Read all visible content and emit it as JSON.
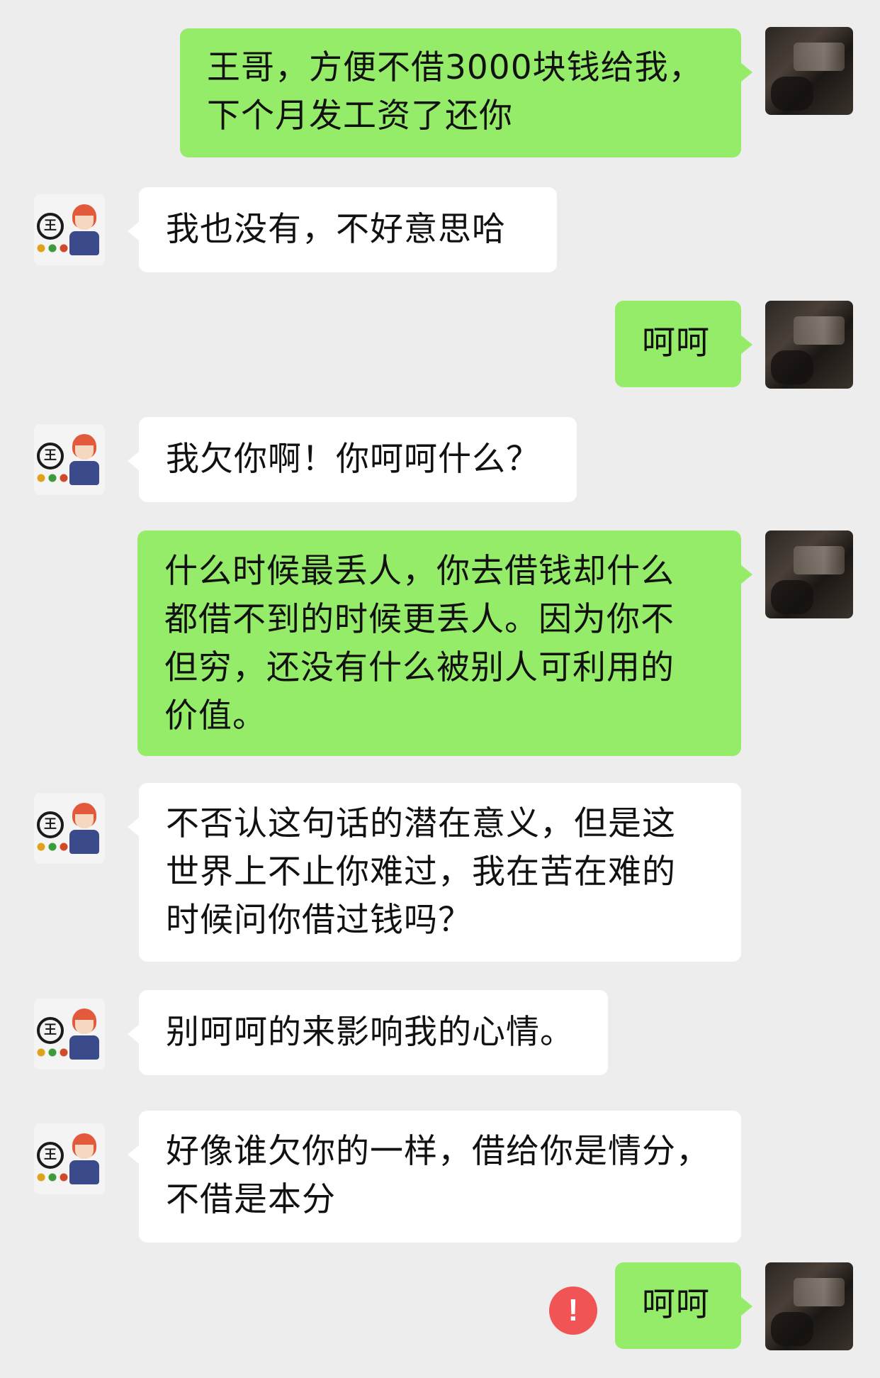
{
  "messages": [
    {
      "sender": "self",
      "text": "王哥，方便不借3000块钱给我，\n下个月发工资了还你"
    },
    {
      "sender": "other",
      "text": "我也没有，不好意思哈"
    },
    {
      "sender": "self",
      "text": "呵呵"
    },
    {
      "sender": "other",
      "text": "我欠你啊！你呵呵什么？"
    },
    {
      "sender": "self",
      "text": "什么时候最丢人，你去借钱却什么\n都借不到的时候更丢人。因为你不\n但穷，还没有什么被别人可利用的\n价值。"
    },
    {
      "sender": "other",
      "text": "不否认这句话的潜在意义，但是这\n世界上不止你难过，我在苦在难的\n时候问你借过钱吗？"
    },
    {
      "sender": "other",
      "text": "别呵呵的来影响我的心情。"
    },
    {
      "sender": "other",
      "text": "好像谁欠你的一样，借给你是情分，\n不借是本分"
    },
    {
      "sender": "self",
      "text": "呵呵",
      "status": "failed"
    }
  ],
  "icons": {
    "self_avatar": "user-photo-avatar",
    "other_avatar": "cartoon-logo-avatar",
    "failed": "error-exclamation-icon"
  },
  "other_avatar_logo_text": "王",
  "error_symbol": "!",
  "colors": {
    "background": "#ededed",
    "outgoing_bubble": "#95ec69",
    "incoming_bubble": "#ffffff",
    "error": "#f05454"
  }
}
